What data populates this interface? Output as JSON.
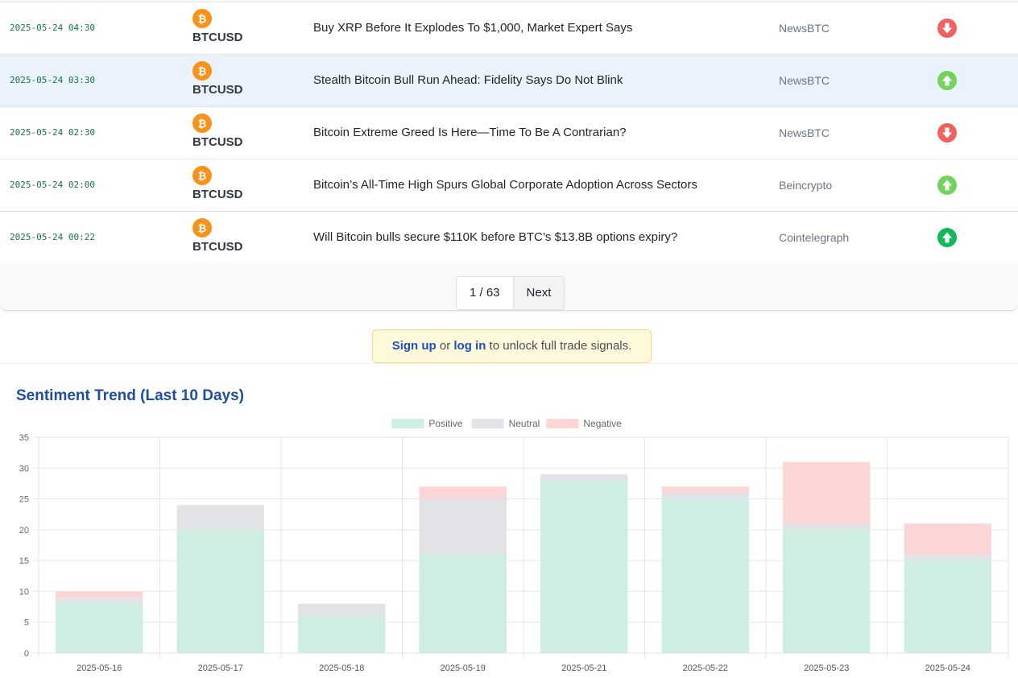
{
  "news": {
    "rows": [
      {
        "time": "2025-05-24 04:30",
        "asset": "BTCUSD",
        "title": "Buy XRP Before It Explodes To $1,000, Market Expert Says",
        "source": "NewsBTC",
        "signal": "down",
        "signal_color": "#f06060"
      },
      {
        "time": "2025-05-24 03:30",
        "asset": "BTCUSD",
        "title": "Stealth Bitcoin Bull Run Ahead: Fidelity Says Do Not Blink",
        "source": "NewsBTC",
        "signal": "up",
        "signal_color": "#74d35a"
      },
      {
        "time": "2025-05-24 02:30",
        "asset": "BTCUSD",
        "title": "Bitcoin Extreme Greed Is Here—Time To Be A Contrarian?",
        "source": "NewsBTC",
        "signal": "down",
        "signal_color": "#f06060"
      },
      {
        "time": "2025-05-24 02:00",
        "asset": "BTCUSD",
        "title": "Bitcoin’s All-Time High Spurs Global Corporate Adoption Across Sectors",
        "source": "Beincrypto",
        "signal": "up",
        "signal_color": "#74d35a"
      },
      {
        "time": "2025-05-24 00:22",
        "asset": "BTCUSD",
        "title": "Will Bitcoin bulls secure $110K before BTC’s $13.8B options expiry?",
        "source": "Cointelegraph",
        "signal": "up",
        "signal_color": "#12b85a"
      }
    ]
  },
  "pagination": {
    "page_info": "1 / 63",
    "next_label": "Next"
  },
  "notice": {
    "signup_label": "Sign up",
    "or_text": "or",
    "login_label": "log in",
    "rest_text": "to unlock full trade signals."
  },
  "chart_section": {
    "title": "Sentiment Trend (Last 10 Days)"
  },
  "colors": {
    "bitcoin": "#f7931a",
    "accent": "#1d4ea0"
  },
  "chart_data": {
    "type": "bar",
    "stacked": true,
    "categories": [
      "2025-05-16",
      "2025-05-17",
      "2025-05-18",
      "2025-05-19",
      "2025-05-21",
      "2025-05-22",
      "2025-05-23",
      "2025-05-24"
    ],
    "series": [
      {
        "name": "Positive",
        "values": [
          8,
          20,
          6,
          16,
          28,
          25,
          20,
          15
        ],
        "color": "#ceeee2"
      },
      {
        "name": "Neutral",
        "values": [
          1,
          4,
          2,
          9,
          1,
          1,
          1,
          1
        ],
        "color": "#e2e3e7"
      },
      {
        "name": "Negative",
        "values": [
          1,
          0,
          0,
          2,
          0,
          1,
          10,
          5
        ],
        "color": "#fcd6d7"
      }
    ],
    "yticks": [
      0,
      5,
      10,
      15,
      20,
      25,
      30,
      35
    ],
    "ylim": [
      0,
      35
    ],
    "grid": true,
    "legend_position": "top-center"
  }
}
